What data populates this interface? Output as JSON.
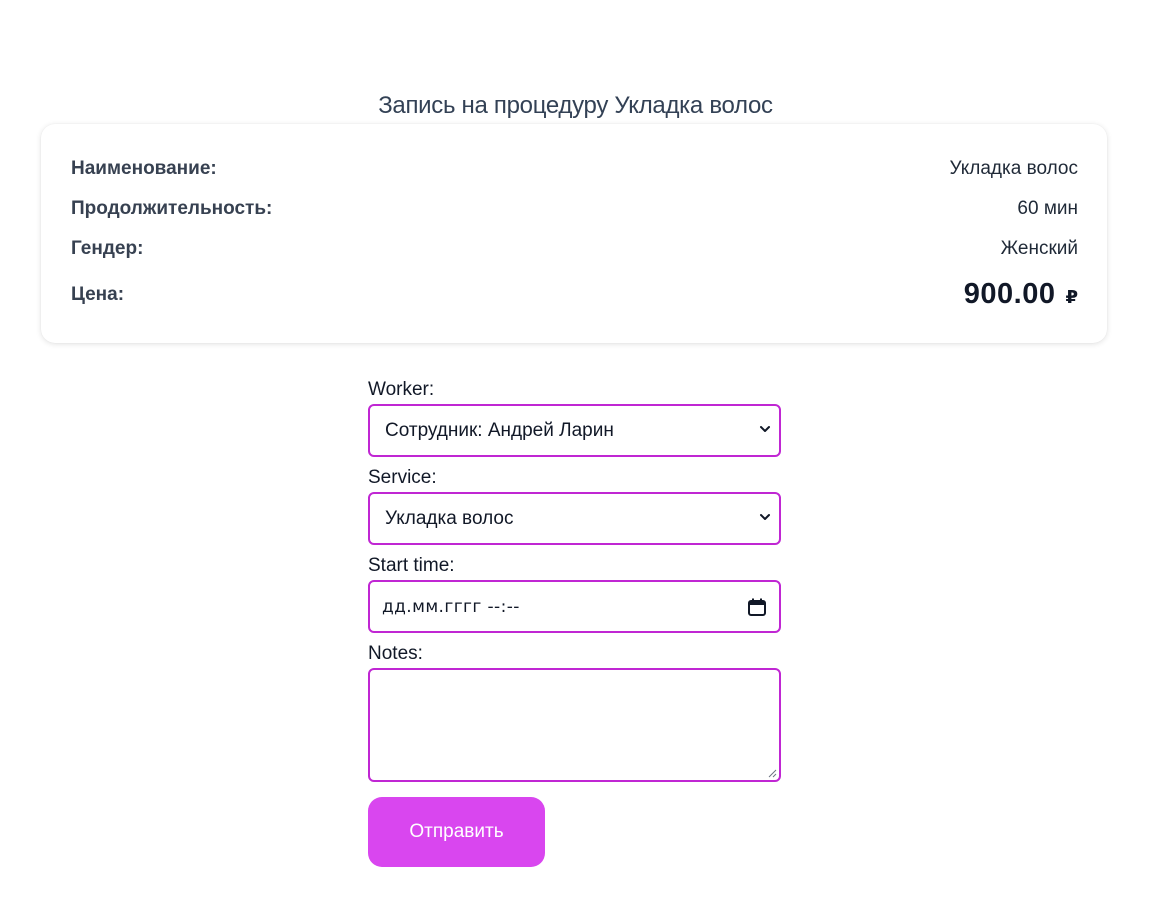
{
  "page": {
    "title": "Запись на процедуру Укладка волос"
  },
  "details": {
    "name_label": "Наименование:",
    "name_value": "Укладка волос",
    "duration_label": "Продолжительность:",
    "duration_value": "60 мин",
    "gender_label": "Гендер:",
    "gender_value": "Женский",
    "price_label": "Цена:",
    "price_value": "900.00",
    "price_currency": "₽"
  },
  "form": {
    "worker_label": "Worker:",
    "worker_selected": "Сотрудник: Андрей Ларин",
    "service_label": "Service:",
    "service_selected": "Укладка волос",
    "start_time_label": "Start time:",
    "start_time_placeholder": "дд.мм.гггг --:--",
    "notes_label": "Notes:",
    "notes_value": "",
    "submit_label": "Отправить"
  },
  "icons": {
    "select_arrow": "chevron-down-icon",
    "date_picker": "calendar-icon",
    "resize": "resize-handle-icon"
  },
  "colors": {
    "accent": "#d946ef",
    "field_border": "#c026d3",
    "title": "#334155"
  }
}
